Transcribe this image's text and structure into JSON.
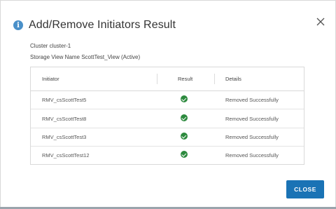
{
  "dialog": {
    "title": "Add/Remove Initiators Result",
    "info_icon": "info-icon",
    "close_icon": "close-icon",
    "cluster_line": "Cluster cluster-1",
    "storage_view_line": "Storage View Name ScottTest_View (Active)",
    "close_button_label": "CLOSE",
    "accent_color": "#1a73b5",
    "success_color": "#2d8a3e"
  },
  "table": {
    "columns": [
      "Initiator",
      "Result",
      "Details"
    ],
    "rows": [
      {
        "initiator": "RMV_csScottTest5",
        "result": "success",
        "details": "Removed Successfully"
      },
      {
        "initiator": "RMV_csScottTest8",
        "result": "success",
        "details": "Removed Successfully"
      },
      {
        "initiator": "RMV_csScottTest3",
        "result": "success",
        "details": "Removed Successfully"
      },
      {
        "initiator": "RMV_csScottTest12",
        "result": "success",
        "details": "Removed Successfully"
      }
    ]
  }
}
